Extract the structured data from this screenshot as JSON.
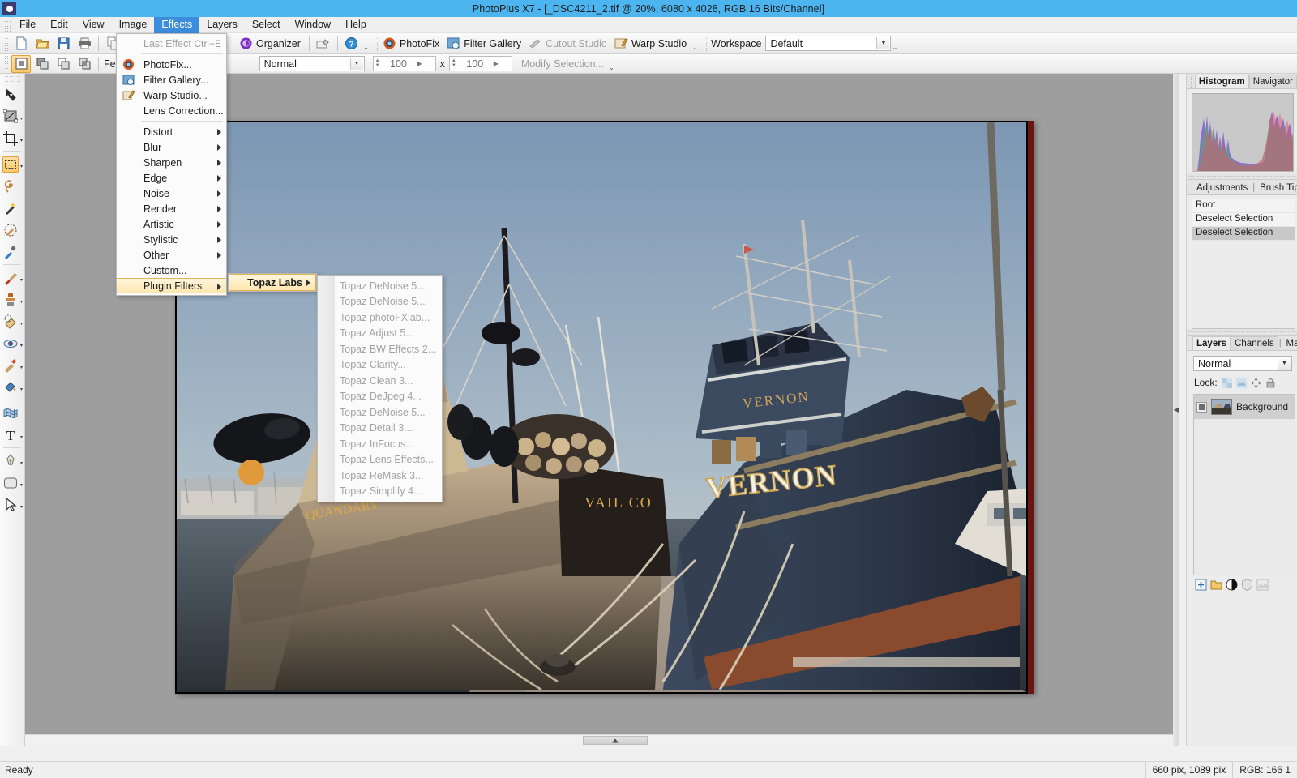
{
  "window": {
    "title": "PhotoPlus X7 - [_DSC4211_2.tif @ 20%, 6080 x 4028, RGB 16 Bits/Channel]",
    "logo_icon": "photoplus-logo-icon"
  },
  "menubar": {
    "items": [
      {
        "label": "File",
        "active": false
      },
      {
        "label": "Edit",
        "active": false
      },
      {
        "label": "View",
        "active": false
      },
      {
        "label": "Image",
        "active": false
      },
      {
        "label": "Effects",
        "active": true
      },
      {
        "label": "Layers",
        "active": false
      },
      {
        "label": "Select",
        "active": false
      },
      {
        "label": "Window",
        "active": false
      },
      {
        "label": "Help",
        "active": false
      }
    ]
  },
  "toolbar_main": {
    "buttons": [
      {
        "name": "new-document-button",
        "icon": "new-file-icon"
      },
      {
        "name": "open-document-button",
        "icon": "open-folder-icon"
      },
      {
        "name": "save-document-button",
        "icon": "save-disk-icon"
      },
      {
        "name": "print-button",
        "icon": "printer-icon"
      },
      {
        "name": "copy-button",
        "icon": "copy-icon"
      },
      {
        "name": "paste-button",
        "icon": "paste-icon"
      },
      {
        "name": "undo-button",
        "icon": "undo-arrow-icon"
      },
      {
        "name": "redo-button",
        "icon": "redo-arrow-icon"
      },
      {
        "name": "cursor-tool-button",
        "icon": "cursor-arrow-icon"
      }
    ],
    "organizer_label": "Organizer",
    "quickfix_icon": "brush-icon",
    "help_icon": "help-question-icon",
    "studio_buttons": [
      {
        "label": "PhotoFix",
        "icon": "photofix-icon",
        "enabled": true
      },
      {
        "label": "Filter Gallery",
        "icon": "filter-gallery-icon",
        "enabled": true
      },
      {
        "label": "Cutout Studio",
        "icon": "cutout-studio-icon",
        "enabled": false
      },
      {
        "label": "Warp Studio",
        "icon": "warp-studio-icon",
        "enabled": true
      }
    ],
    "workspace_label": "Workspace",
    "workspace_value": "Default"
  },
  "toolbar_options": {
    "mode_buttons": [
      {
        "name": "new-selection-button",
        "icon": "new-selection-icon",
        "selected": true
      },
      {
        "name": "add-selection-button",
        "icon": "add-selection-icon",
        "selected": false
      },
      {
        "name": "subtract-selection-button",
        "icon": "subtract-selection-icon",
        "selected": false
      },
      {
        "name": "intersect-selection-button",
        "icon": "intersect-selection-icon",
        "selected": false
      }
    ],
    "feather_label": "Feather:",
    "blend_mode_value": "Normal",
    "width_value": "100",
    "separator_label": "x",
    "height_value": "100",
    "modify_selection_label": "Modify Selection..."
  },
  "tools": [
    {
      "name": "move-tool",
      "icon": "move-arrow-icon",
      "selected": false,
      "has_flyout": false
    },
    {
      "name": "transform-tool",
      "icon": "transform-icon",
      "selected": false,
      "has_flyout": true
    },
    {
      "name": "crop-tool",
      "icon": "crop-icon",
      "selected": false,
      "has_flyout": true
    },
    {
      "name": "rectangular-marquee-tool",
      "icon": "marquee-select-icon",
      "selected": true,
      "has_flyout": true
    },
    {
      "name": "lasso-tool",
      "icon": "lasso-icon",
      "selected": false,
      "has_flyout": false
    },
    {
      "name": "magic-wand-tool",
      "icon": "magic-wand-icon",
      "selected": false,
      "has_flyout": false
    },
    {
      "name": "selection-brush-tool",
      "icon": "selection-brush-icon",
      "selected": false,
      "has_flyout": false
    },
    {
      "name": "color-picker-tool",
      "icon": "eyedropper-icon",
      "selected": false,
      "has_flyout": false
    },
    {
      "name": "paintbrush-tool",
      "icon": "paintbrush-icon",
      "selected": false,
      "has_flyout": true
    },
    {
      "name": "clone-stamp-tool",
      "icon": "clone-stamp-icon",
      "selected": false,
      "has_flyout": true
    },
    {
      "name": "eraser-tool",
      "icon": "eraser-icon",
      "selected": false,
      "has_flyout": true
    },
    {
      "name": "red-eye-tool",
      "icon": "red-eye-icon",
      "selected": false,
      "has_flyout": true
    },
    {
      "name": "smudge-tool",
      "icon": "smudge-icon",
      "selected": false,
      "has_flyout": true
    },
    {
      "name": "flood-fill-tool",
      "icon": "paint-bucket-icon",
      "selected": false,
      "has_flyout": true
    },
    {
      "name": "mesh-warp-tool",
      "icon": "mesh-warp-icon",
      "selected": false,
      "has_flyout": false
    },
    {
      "name": "text-tool",
      "icon": "text-t-icon",
      "selected": false,
      "has_flyout": true
    },
    {
      "name": "pen-tool",
      "icon": "pen-nib-icon",
      "selected": false,
      "has_flyout": true
    },
    {
      "name": "shape-tool",
      "icon": "rounded-rectangle-icon",
      "selected": false,
      "has_flyout": true
    },
    {
      "name": "node-edit-tool",
      "icon": "node-arrow-icon",
      "selected": false,
      "has_flyout": true
    }
  ],
  "effects_menu": {
    "items": [
      {
        "label": "Last Effect",
        "shortcut": "Ctrl+E",
        "disabled": true,
        "icon": null,
        "submenu": false
      },
      {
        "separator": true
      },
      {
        "label": "PhotoFix...",
        "icon": "photofix-icon",
        "disabled": false,
        "submenu": false
      },
      {
        "label": "Filter Gallery...",
        "icon": "filter-gallery-icon",
        "disabled": false,
        "submenu": false
      },
      {
        "label": "Warp Studio...",
        "icon": "warp-studio-icon",
        "disabled": false,
        "submenu": false
      },
      {
        "label": "Lens Correction...",
        "icon": null,
        "disabled": false,
        "submenu": false
      },
      {
        "separator": true
      },
      {
        "label": "Distort",
        "icon": null,
        "disabled": false,
        "submenu": true
      },
      {
        "label": "Blur",
        "icon": null,
        "disabled": false,
        "submenu": true
      },
      {
        "label": "Sharpen",
        "icon": null,
        "disabled": false,
        "submenu": true
      },
      {
        "label": "Edge",
        "icon": null,
        "disabled": false,
        "submenu": true
      },
      {
        "label": "Noise",
        "icon": null,
        "disabled": false,
        "submenu": true
      },
      {
        "label": "Render",
        "icon": null,
        "disabled": false,
        "submenu": true
      },
      {
        "label": "Artistic",
        "icon": null,
        "disabled": false,
        "submenu": true
      },
      {
        "label": "Stylistic",
        "icon": null,
        "disabled": false,
        "submenu": true
      },
      {
        "label": "Other",
        "icon": null,
        "disabled": false,
        "submenu": true
      },
      {
        "label": "Custom...",
        "icon": null,
        "disabled": false,
        "submenu": false
      },
      {
        "label": "Plugin Filters",
        "icon": null,
        "disabled": false,
        "submenu": true,
        "highlighted": true
      }
    ]
  },
  "plugin_submenu": {
    "label": "Topaz Labs",
    "highlighted": true
  },
  "topaz_menu": {
    "items": [
      {
        "label": "Topaz DeNoise 5...",
        "disabled": true
      },
      {
        "label": "Topaz DeNoise 5...",
        "disabled": true
      },
      {
        "label": "Topaz photoFXlab...",
        "disabled": true
      },
      {
        "label": "Topaz Adjust 5...",
        "disabled": true
      },
      {
        "label": "Topaz BW Effects 2...",
        "disabled": true
      },
      {
        "label": "Topaz Clarity...",
        "disabled": true
      },
      {
        "label": "Topaz Clean 3...",
        "disabled": true
      },
      {
        "label": "Topaz DeJpeg 4...",
        "disabled": true
      },
      {
        "label": "Topaz DeNoise 5...",
        "disabled": true
      },
      {
        "label": "Topaz Detail 3...",
        "disabled": true
      },
      {
        "label": "Topaz InFocus...",
        "disabled": true
      },
      {
        "label": "Topaz Lens Effects...",
        "disabled": true
      },
      {
        "label": "Topaz ReMask 3...",
        "disabled": true
      },
      {
        "label": "Topaz Simplify 4...",
        "disabled": true
      }
    ]
  },
  "right_dock": {
    "histogram_panel": {
      "tabs": [
        {
          "label": "Histogram",
          "active": true
        },
        {
          "label": "Navigator",
          "active": false
        }
      ]
    },
    "adjustments_panel": {
      "tabs": [
        {
          "label": "Adjustments",
          "active": true
        },
        {
          "label": "Brush Tip",
          "active": false
        }
      ],
      "rows": [
        {
          "label": "Root",
          "selected": false
        },
        {
          "label": "Deselect Selection",
          "selected": false
        },
        {
          "label": "Deselect Selection",
          "selected": true
        }
      ]
    },
    "layers_panel": {
      "tabs": [
        {
          "label": "Layers",
          "active": true
        },
        {
          "label": "Channels",
          "active": false
        },
        {
          "label": "Mask",
          "active": false
        }
      ],
      "blend_mode": "Normal",
      "lock_label": "Lock:",
      "lock_icons": [
        "lock-transparency-icon",
        "lock-image-icon",
        "lock-position-icon",
        "lock-all-icon"
      ],
      "layers": [
        {
          "name": "Background",
          "visible": true,
          "selected": true
        }
      ],
      "buttons": [
        {
          "name": "add-layer-button",
          "icon": "add-layer-icon"
        },
        {
          "name": "add-group-button",
          "icon": "folder-icon"
        },
        {
          "name": "adjustment-layer-button",
          "icon": "half-circle-icon"
        },
        {
          "name": "layer-mask-button",
          "icon": "mask-shield-icon"
        },
        {
          "name": "layer-effects-button",
          "icon": "effects-icon"
        }
      ]
    }
  },
  "statusbar": {
    "status_text": "Ready",
    "cursor_position": "660 pix, 1089 pix",
    "color_readout": "RGB: 166 1"
  },
  "image": {
    "boat_left_bow_name": "QUANDARY",
    "boat_left_stern_name": "VAIL CO",
    "boat_right_wheelhouse_name": "VERNON",
    "boat_right_hull_name": "VERNON",
    "zoom_level": "20%",
    "dimensions": "6080 x 4028"
  },
  "colors": {
    "title_bar": "#4cb5ef",
    "menu_highlight": "#3c8ddc",
    "menu_item_highlight": "#fde6b0",
    "canvas_background": "#9e9e9e",
    "panel_background": "#ececec"
  }
}
